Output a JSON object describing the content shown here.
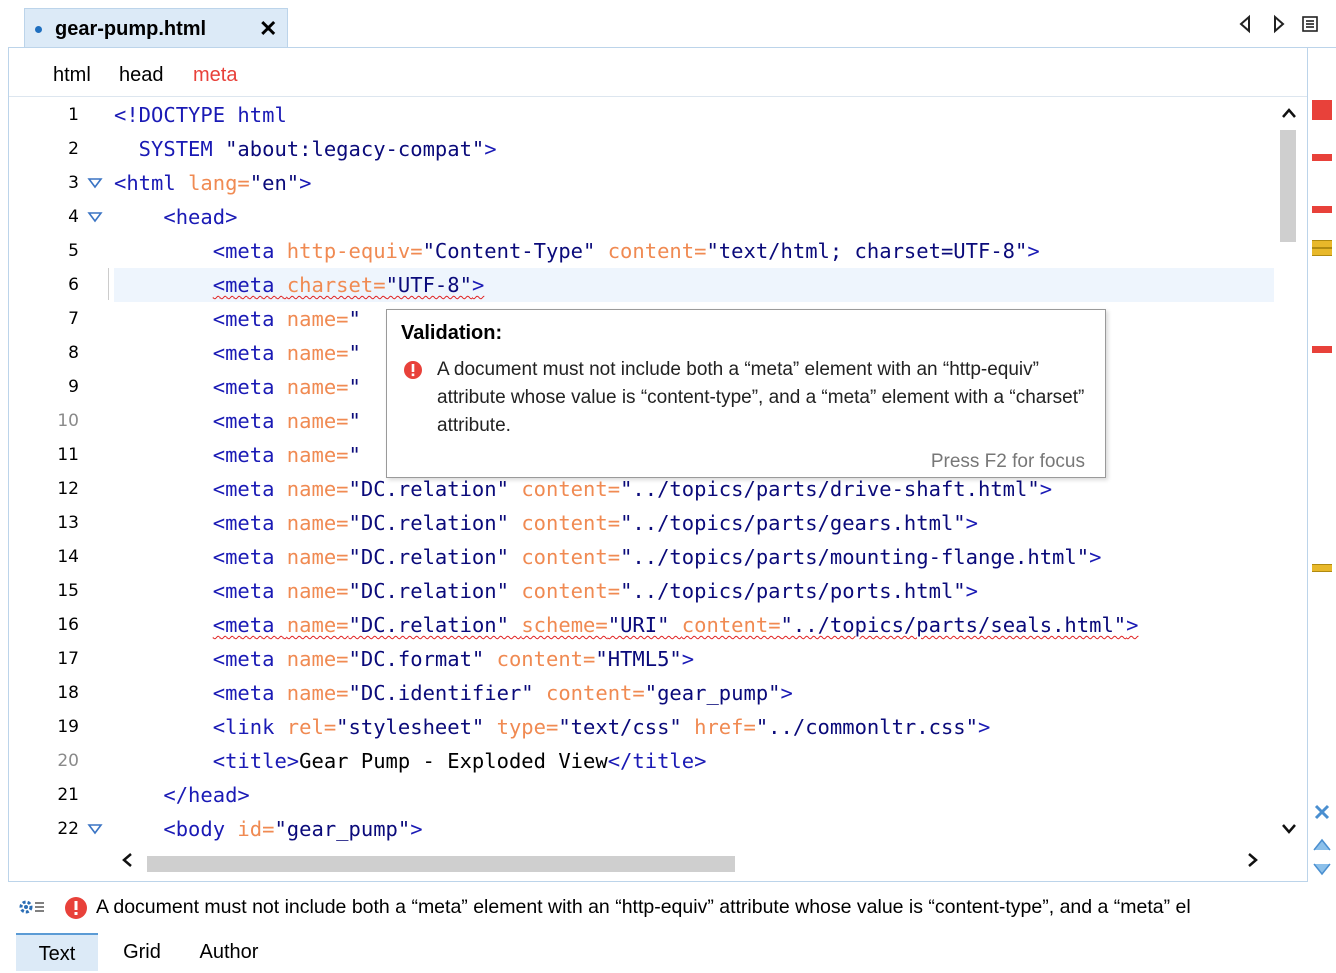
{
  "tab": {
    "title": "gear-pump.html",
    "close": "✕"
  },
  "toolbar": {
    "prev_icon": "triangle-left-icon",
    "next_icon": "triangle-right-icon",
    "menu_icon": "list-menu-icon"
  },
  "breadcrumb": [
    "html",
    "head",
    "meta"
  ],
  "line_numbers": [
    "1",
    "2",
    "3",
    "4",
    "5",
    "6",
    "7",
    "8",
    "9",
    "10",
    "11",
    "12",
    "13",
    "14",
    "15",
    "16",
    "17",
    "18",
    "19",
    "20",
    "21",
    "22"
  ],
  "code_lines": [
    [
      [
        "tg",
        "<!DOCTYPE html"
      ]
    ],
    [
      [
        "tg",
        "  SYSTEM "
      ],
      [
        "vl",
        "\"about:legacy-compat\""
      ],
      [
        "tg",
        ">"
      ]
    ],
    [
      [
        "tg",
        "<html "
      ],
      [
        "at",
        "lang="
      ],
      [
        "vl",
        "\"en\""
      ],
      [
        "tg",
        ">"
      ]
    ],
    [
      [
        "tg",
        "    <head>"
      ]
    ],
    [
      [
        "tg",
        "        <meta "
      ],
      [
        "at",
        "http-equiv="
      ],
      [
        "vl",
        "\"Content-Type\" "
      ],
      [
        "at",
        "content="
      ],
      [
        "vl",
        "\"text/html; charset=UTF-8\""
      ],
      [
        "tg",
        ">"
      ]
    ],
    [
      [
        "tg",
        "        "
      ],
      [
        "tg wavy",
        "<meta "
      ],
      [
        "at wavy",
        "charset="
      ],
      [
        "vl wavy",
        "\"UTF-8\""
      ],
      [
        "tg wavy",
        ">"
      ]
    ],
    [
      [
        "tg",
        "        <meta "
      ],
      [
        "at",
        "name="
      ],
      [
        "vl",
        "\""
      ]
    ],
    [
      [
        "tg",
        "        <meta "
      ],
      [
        "at",
        "name="
      ],
      [
        "vl",
        "\""
      ]
    ],
    [
      [
        "tg",
        "        <meta "
      ],
      [
        "at",
        "name="
      ],
      [
        "vl",
        "\""
      ]
    ],
    [
      [
        "tg",
        "        <meta "
      ],
      [
        "at",
        "name="
      ],
      [
        "vl",
        "\""
      ]
    ],
    [
      [
        "tg",
        "        <meta "
      ],
      [
        "at",
        "name="
      ],
      [
        "vl",
        "\"                                              "
      ],
      [
        "vl",
        "\""
      ],
      [
        "tg",
        ">"
      ]
    ],
    [
      [
        "tg",
        "        <meta "
      ],
      [
        "at",
        "name="
      ],
      [
        "vl",
        "\"DC.relation\" "
      ],
      [
        "at",
        "content="
      ],
      [
        "vl",
        "\"../topics/parts/drive-shaft.html\""
      ],
      [
        "tg",
        ">"
      ]
    ],
    [
      [
        "tg",
        "        <meta "
      ],
      [
        "at",
        "name="
      ],
      [
        "vl",
        "\"DC.relation\" "
      ],
      [
        "at",
        "content="
      ],
      [
        "vl",
        "\"../topics/parts/gears.html\""
      ],
      [
        "tg",
        ">"
      ]
    ],
    [
      [
        "tg",
        "        <meta "
      ],
      [
        "at",
        "name="
      ],
      [
        "vl",
        "\"DC.relation\" "
      ],
      [
        "at",
        "content="
      ],
      [
        "vl",
        "\"../topics/parts/mounting-flange.html\""
      ],
      [
        "tg",
        ">"
      ]
    ],
    [
      [
        "tg",
        "        <meta "
      ],
      [
        "at",
        "name="
      ],
      [
        "vl",
        "\"DC.relation\" "
      ],
      [
        "at",
        "content="
      ],
      [
        "vl",
        "\"../topics/parts/ports.html\""
      ],
      [
        "tg",
        ">"
      ]
    ],
    [
      [
        "tg",
        "        "
      ],
      [
        "tg wavy",
        "<meta "
      ],
      [
        "at wavy",
        "name="
      ],
      [
        "vl wavy",
        "\"DC.relation\" "
      ],
      [
        "at wavy",
        "scheme="
      ],
      [
        "vl wavy",
        "\"URI\" "
      ],
      [
        "at wavy",
        "content="
      ],
      [
        "vl wavy",
        "\"../topics/parts/seals.html\""
      ],
      [
        "tg wavy",
        ">"
      ]
    ],
    [
      [
        "tg",
        "        <meta "
      ],
      [
        "at",
        "name="
      ],
      [
        "vl",
        "\"DC.format\" "
      ],
      [
        "at",
        "content="
      ],
      [
        "vl",
        "\"HTML5\""
      ],
      [
        "tg",
        ">"
      ]
    ],
    [
      [
        "tg",
        "        <meta "
      ],
      [
        "at",
        "name="
      ],
      [
        "vl",
        "\"DC.identifier\" "
      ],
      [
        "at",
        "content="
      ],
      [
        "vl",
        "\"gear_pump\""
      ],
      [
        "tg",
        ">"
      ]
    ],
    [
      [
        "tg",
        "        <link "
      ],
      [
        "at",
        "rel="
      ],
      [
        "vl",
        "\"stylesheet\" "
      ],
      [
        "at",
        "type="
      ],
      [
        "vl",
        "\"text/css\" "
      ],
      [
        "at",
        "href="
      ],
      [
        "vl",
        "\"../commonltr.css\""
      ],
      [
        "tg",
        ">"
      ]
    ],
    [
      [
        "tg",
        "        <title>"
      ],
      [
        "tx",
        "Gear Pump - Exploded View"
      ],
      [
        "tg",
        "</title>"
      ]
    ],
    [
      [
        "tg",
        "    </head>"
      ]
    ],
    [
      [
        "tg",
        "    <body "
      ],
      [
        "at",
        "id="
      ],
      [
        "vl",
        "\"gear_pump\""
      ],
      [
        "tg",
        ">"
      ]
    ]
  ],
  "tooltip": {
    "title": "Validation:",
    "message": "A document must not include both a “meta” element with an “http-equiv” attribute whose value is “content-type”, and a “meta” element with a “charset” attribute.",
    "hint": "Press F2 for focus"
  },
  "status": {
    "message": "A document must not include both a “meta” element with an “http-equiv” attribute whose value is “content-type”, and a “meta” el"
  },
  "mode_tabs": {
    "text": "Text",
    "grid": "Grid",
    "author": "Author"
  },
  "colors": {
    "error": "#e8413a",
    "warning": "#e8b82a",
    "accent": "#dceaf7",
    "tag": "#1a1ab5",
    "attribute": "#f08a52"
  }
}
